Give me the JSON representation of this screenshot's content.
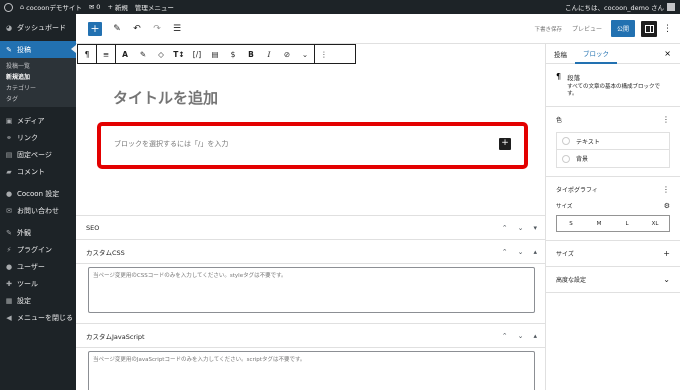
{
  "admin_bar": {
    "site_name": "cocoonデモサイト",
    "comments_count": "0",
    "new_label": "新規",
    "admin_menu_label": "管理メニュー",
    "greeting": "こんにちは、cocoon_demo さん"
  },
  "sidebar": {
    "dashboard": "ダッシュボード",
    "posts": "投稿",
    "sub_items": [
      "投稿一覧",
      "新規追加",
      "カテゴリー",
      "タグ"
    ],
    "media": "メディア",
    "links": "リンク",
    "pages": "固定ページ",
    "comments": "コメント",
    "cocoon_settings": "Cocoon 設定",
    "contact": "お問い合わせ",
    "appearance": "外観",
    "plugins": "プラグイン",
    "users": "ユーザー",
    "tools": "ツール",
    "settings": "設定",
    "collapse": "メニューを閉じる"
  },
  "top_toolbar": {
    "save_draft": "下書き保存",
    "preview": "プレビュー",
    "publish": "公開"
  },
  "block_toolbar": {
    "paragraph_icon": "¶",
    "align_icon": "≡",
    "font_icon": "A",
    "highlight_icon": "✎",
    "tag_icon": "◇",
    "text_size_icon": "T↕",
    "code_icon": "[/]",
    "note_icon": "▤",
    "dollar_icon": "$",
    "bold": "B",
    "italic": "I",
    "link_icon": "⊘",
    "more_icon": "⌄",
    "options_icon": "⋮"
  },
  "canvas": {
    "title_placeholder": "タイトルを追加",
    "block_placeholder": "ブロックを選択するには「/」を入力"
  },
  "meta_boxes": {
    "seo": "SEO",
    "custom_css": "カスタムCSS",
    "css_placeholder": "当ページ変更用のCSSコードのみを入力してください。styleタグは不要です。",
    "custom_js": "カスタムJavaScript",
    "js_placeholder": "当ページ変更用のJavaScriptコードのみを入力してください。scriptタグは不要です。"
  },
  "right_panel": {
    "tab_post": "投稿",
    "tab_block": "ブロック",
    "block_name": "段落",
    "block_desc": "すべての文章の基本の構成ブロックです。",
    "color": "色",
    "text_color": "テキスト",
    "bg_color": "背景",
    "typography": "タイポグラフィ",
    "size": "サイズ",
    "sizes": [
      "S",
      "M",
      "L",
      "XL"
    ],
    "dimensions": "サイズ",
    "advanced": "高度な設定"
  },
  "colors": {
    "admin_dark": "#1d2327",
    "accent": "#2271b1",
    "highlight_red": "#e30000"
  }
}
